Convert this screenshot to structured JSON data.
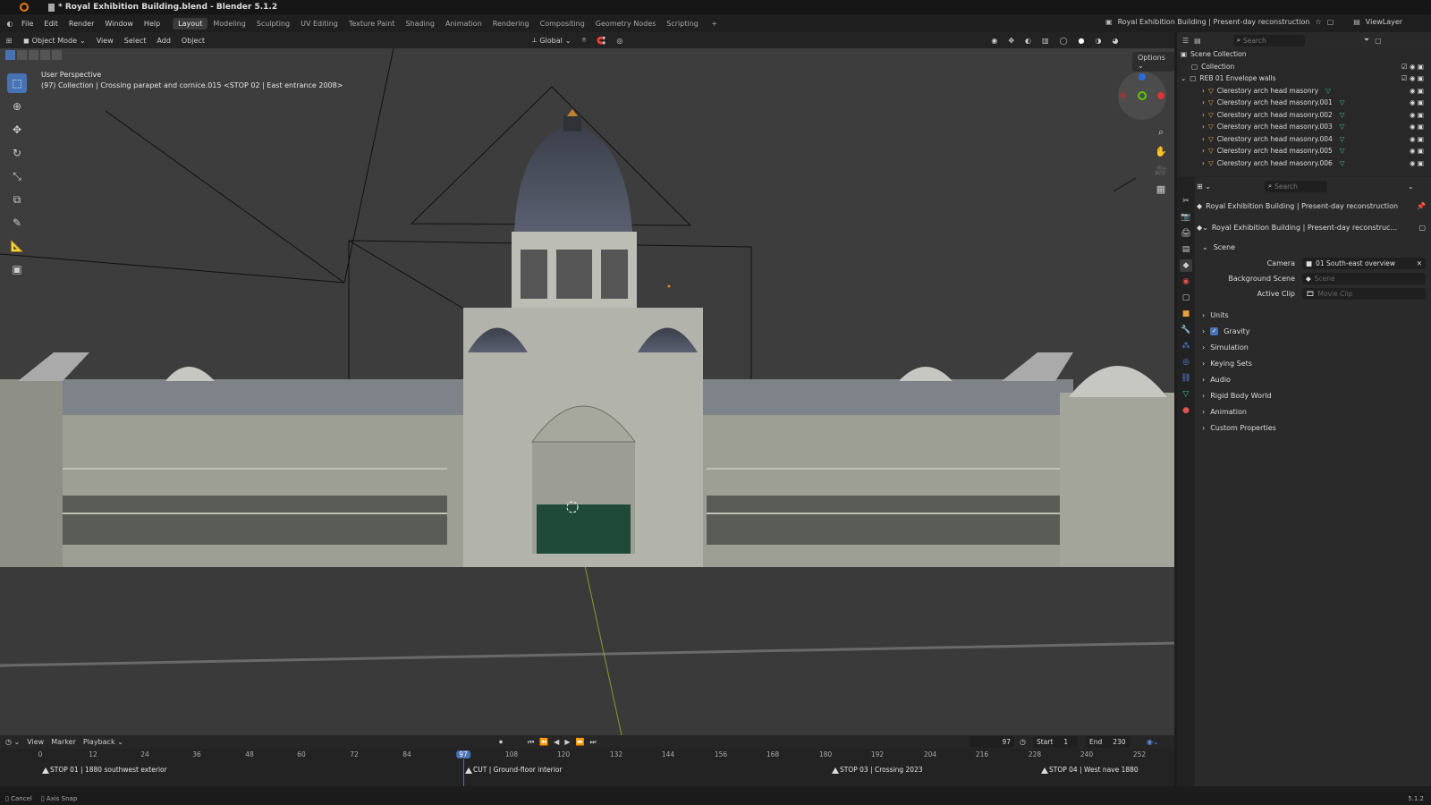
{
  "window": {
    "title": "* Royal Exhibition Building.blend - Blender 5.1.2"
  },
  "menu": [
    "File",
    "Edit",
    "Render",
    "Window",
    "Help"
  ],
  "workspaces": [
    "Layout",
    "Modeling",
    "Sculpting",
    "UV Editing",
    "Texture Paint",
    "Shading",
    "Animation",
    "Rendering",
    "Compositing",
    "Geometry Nodes",
    "Scripting"
  ],
  "active_workspace": "Layout",
  "topbar_right": {
    "scene": "Royal Exhibition Building | Present-day reconstruction",
    "view_layer": "ViewLayer"
  },
  "viewport_header": {
    "mode": "Object Mode",
    "view": "View",
    "select": "Select",
    "add": "Add",
    "object": "Object",
    "orientation": "Global",
    "options": "Options"
  },
  "viewport_info": {
    "line1": "User Perspective",
    "line2": "(97) Collection | Crossing parapet and cornice.015 <STOP 02 | East entrance 2008>"
  },
  "outliner": {
    "search_placeholder": "Search",
    "root": "Scene Collection",
    "collection": "Collection",
    "group": "REB 01 Envelope walls",
    "items": [
      "Clerestory arch head masonry",
      "Clerestory arch head masonry.001",
      "Clerestory arch head masonry.002",
      "Clerestory arch head masonry.003",
      "Clerestory arch head masonry.004",
      "Clerestory arch head masonry.005",
      "Clerestory arch head masonry.006"
    ]
  },
  "properties": {
    "search_placeholder": "Search",
    "scene_name": "Royal Exhibition Building | Present-day reconstruction",
    "scene_selector": "Royal Exhibition Building | Present-day reconstruc...",
    "scene_panel": "Scene",
    "camera_label": "Camera",
    "camera_value": "01 South-east overview",
    "background_label": "Background Scene",
    "background_placeholder": "Scene",
    "clip_label": "Active Clip",
    "clip_placeholder": "Movie Clip",
    "sections": [
      "Units",
      "Gravity",
      "Simulation",
      "Keying Sets",
      "Audio",
      "Rigid Body World",
      "Animation",
      "Custom Properties"
    ]
  },
  "timeline": {
    "view": "View",
    "marker": "Marker",
    "playback": "Playback",
    "current_frame": "97",
    "start_label": "Start",
    "start": "1",
    "end_label": "End",
    "end": "230",
    "ruler": [
      "0",
      "12",
      "24",
      "36",
      "48",
      "60",
      "72",
      "84",
      "97",
      "108",
      "120",
      "132",
      "144",
      "156",
      "168",
      "180",
      "192",
      "204",
      "216",
      "228",
      "240",
      "252"
    ],
    "markers": [
      "STOP 01 | 1880 southwest exterior",
      "CUT | Ground-floor interior",
      "STOP 03 | Crossing 2023",
      "STOP 04 | West nave 1880"
    ]
  },
  "status": {
    "cancel": "Cancel",
    "axis_snap": "Axis Snap",
    "version": "5.1.2"
  }
}
